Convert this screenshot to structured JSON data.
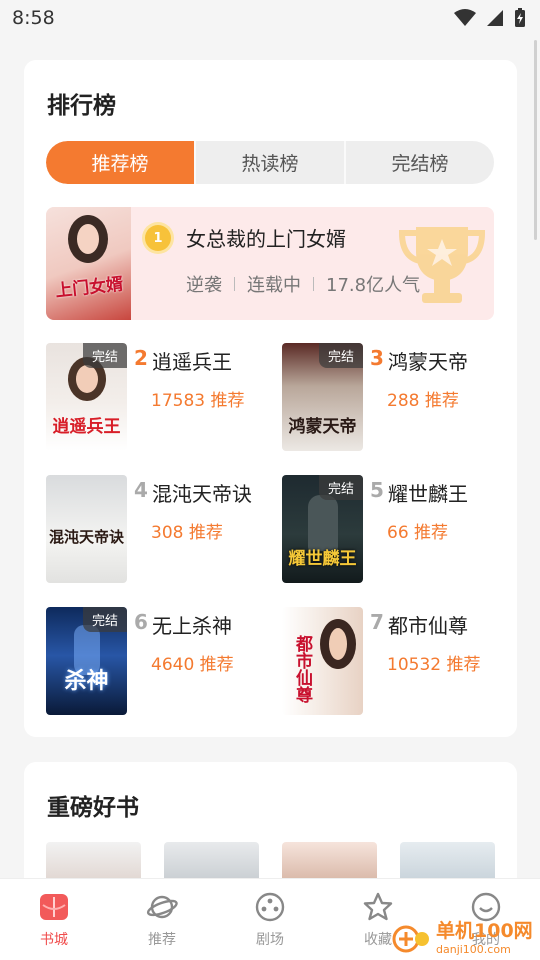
{
  "status_bar": {
    "time": "8:58"
  },
  "ranking": {
    "title": "排行榜",
    "tabs": [
      {
        "label": "推荐榜",
        "active": true
      },
      {
        "label": "热读榜",
        "active": false
      },
      {
        "label": "完结榜",
        "active": false
      }
    ],
    "top1": {
      "rank": "1",
      "title": "女总裁的上门女婿",
      "cover_text": "上门女婿",
      "tags": [
        "逆袭",
        "连载中",
        "17.8亿人气"
      ]
    },
    "books": [
      {
        "rank": "2",
        "title": "逍遥兵王",
        "recommend": "17583 推荐",
        "badge": "完结",
        "cover_text": "逍遥兵王"
      },
      {
        "rank": "3",
        "title": "鸿蒙天帝",
        "recommend": "288 推荐",
        "badge": "完结",
        "cover_text": "鸿蒙天帝"
      },
      {
        "rank": "4",
        "title": "混沌天帝诀",
        "recommend": "308 推荐",
        "badge": "",
        "cover_text": "混沌天帝诀"
      },
      {
        "rank": "5",
        "title": "耀世麟王",
        "recommend": "66 推荐",
        "badge": "完结",
        "cover_text": "耀世麟王"
      },
      {
        "rank": "6",
        "title": "无上杀神",
        "recommend": "4640 推荐",
        "badge": "完结",
        "cover_text": "杀神"
      },
      {
        "rank": "7",
        "title": "都市仙尊",
        "recommend": "10532 推荐",
        "badge": "",
        "cover_text": "都市仙尊"
      }
    ]
  },
  "heavy": {
    "title": "重磅好书"
  },
  "nav": [
    {
      "label": "书城",
      "icon": "book-icon",
      "active": true
    },
    {
      "label": "推荐",
      "icon": "planet-icon",
      "active": false
    },
    {
      "label": "剧场",
      "icon": "film-reel-icon",
      "active": false
    },
    {
      "label": "收藏",
      "icon": "star-icon",
      "active": false
    },
    {
      "label": "我的",
      "icon": "smile-icon",
      "active": false
    }
  ],
  "watermark": {
    "line1": "单机100网",
    "line2": "danji100.com"
  },
  "colors": {
    "accent": "#f47a30",
    "nav_active": "#f04c4c"
  }
}
